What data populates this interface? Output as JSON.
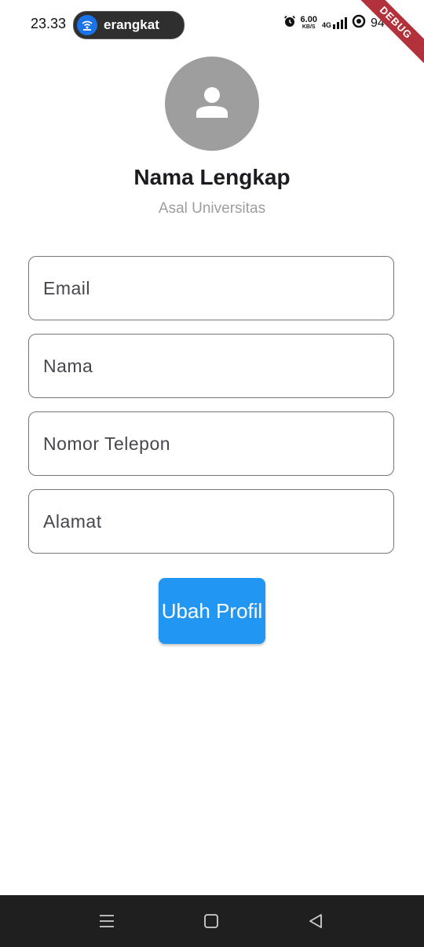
{
  "status_bar": {
    "time": "23.33",
    "notification_pill": "erangkat",
    "net_speed": "6.00",
    "net_speed_unit": "KB/S",
    "network_type": "4G",
    "battery": "94%"
  },
  "debug_banner": "DEBUG",
  "profile": {
    "name": "Nama Lengkap",
    "university": "Asal Universitas"
  },
  "form": {
    "email_placeholder": "Email",
    "name_placeholder": "Nama",
    "phone_placeholder": "Nomor Telepon",
    "address_placeholder": "Alamat"
  },
  "actions": {
    "submit_label": "Ubah Profil"
  },
  "colors": {
    "primary": "#2196f3",
    "avatar_bg": "#9e9e9e",
    "debug_banner": "#b3313b",
    "nav_bar": "#1f1f1f"
  },
  "icons": {
    "avatar": "person-icon",
    "pill": "wifi-icon",
    "status": [
      "alarm-icon",
      "signal-icon",
      "battery-ring-icon"
    ],
    "nav": [
      "menu-icon",
      "home-icon",
      "back-icon"
    ]
  }
}
